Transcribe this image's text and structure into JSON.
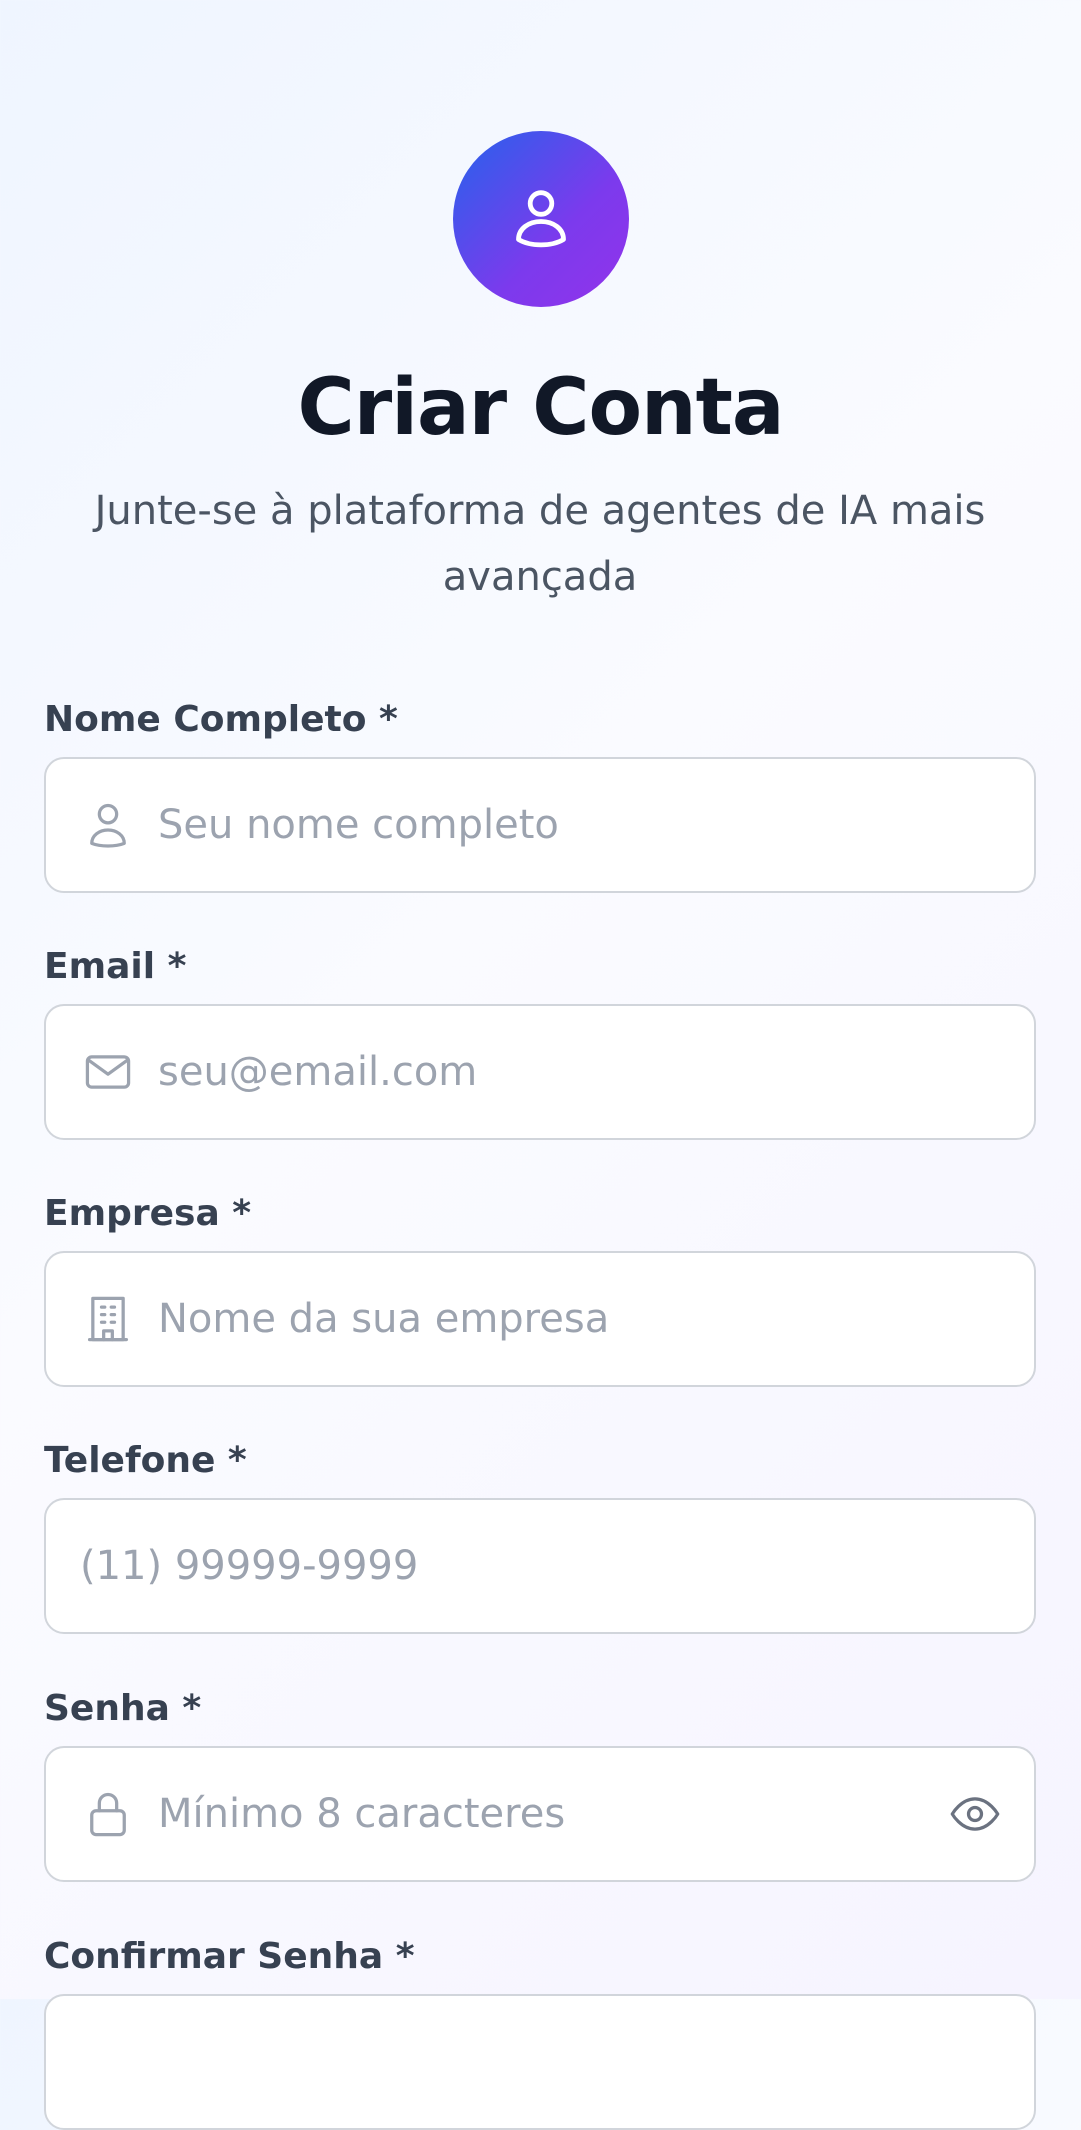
{
  "header": {
    "avatar_icon": "user-icon",
    "title": "Criar Conta",
    "subtitle": "Junte-se à plataforma de agentes de IA mais avançada"
  },
  "form": {
    "fields": [
      {
        "label": "Nome Completo *",
        "placeholder": "Seu nome completo",
        "value": "",
        "icon": "user-icon"
      },
      {
        "label": "Email *",
        "placeholder": "seu@email.com",
        "value": "",
        "icon": "mail-icon"
      },
      {
        "label": "Empresa *",
        "placeholder": "Nome da sua empresa",
        "value": "",
        "icon": "building-icon"
      },
      {
        "label": "Telefone *",
        "placeholder": "(11) 99999-9999",
        "value": ""
      },
      {
        "label": "Senha *",
        "placeholder": "Mínimo 8 caracteres",
        "value": "",
        "icon": "lock-icon",
        "trailing_icon": "eye-icon"
      },
      {
        "label": "Confirmar Senha *"
      }
    ]
  },
  "colors": {
    "accent_gradient_start": "#2563eb",
    "accent_gradient_end": "#9333ea",
    "title": "#111827",
    "label": "#374151",
    "placeholder": "#9ca3af",
    "border": "#d1d5db"
  }
}
